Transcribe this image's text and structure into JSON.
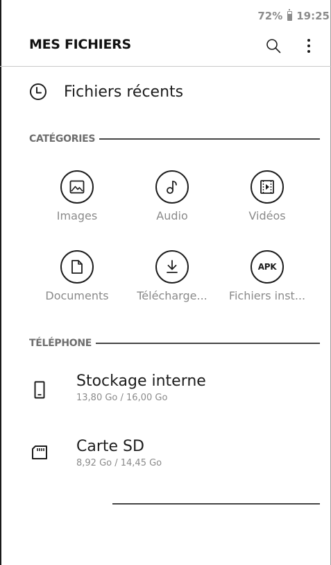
{
  "status_bar": {
    "battery": "72%",
    "time": "19:25"
  },
  "header": {
    "title": "MES FICHIERS",
    "search_icon": "search-icon",
    "more_icon": "more-vert-icon"
  },
  "recent": {
    "label": "Fichiers récents",
    "icon": "clock-icon"
  },
  "categories": {
    "title": "CATÉGORIES",
    "items": [
      {
        "label": "Images",
        "icon": "image-icon"
      },
      {
        "label": "Audio",
        "icon": "music-note-icon"
      },
      {
        "label": "Vidéos",
        "icon": "video-icon"
      },
      {
        "label": "Documents",
        "icon": "document-icon"
      },
      {
        "label": "Télécharge...",
        "icon": "download-icon"
      },
      {
        "label": "Fichiers inst...",
        "icon": "apk-icon",
        "icon_text": "APK"
      }
    ]
  },
  "phone": {
    "title": "TÉLÉPHONE",
    "storages": [
      {
        "name": "Stockage interne",
        "size": "13,80 Go / 16,00 Go",
        "icon": "phone-storage-icon"
      },
      {
        "name": "Carte SD",
        "size": "8,92 Go / 14,45 Go",
        "icon": "sd-card-icon"
      }
    ]
  },
  "colors": {
    "text": "#1c1c1c",
    "muted": "#8a8a8a",
    "section": "#6e6e6e"
  }
}
